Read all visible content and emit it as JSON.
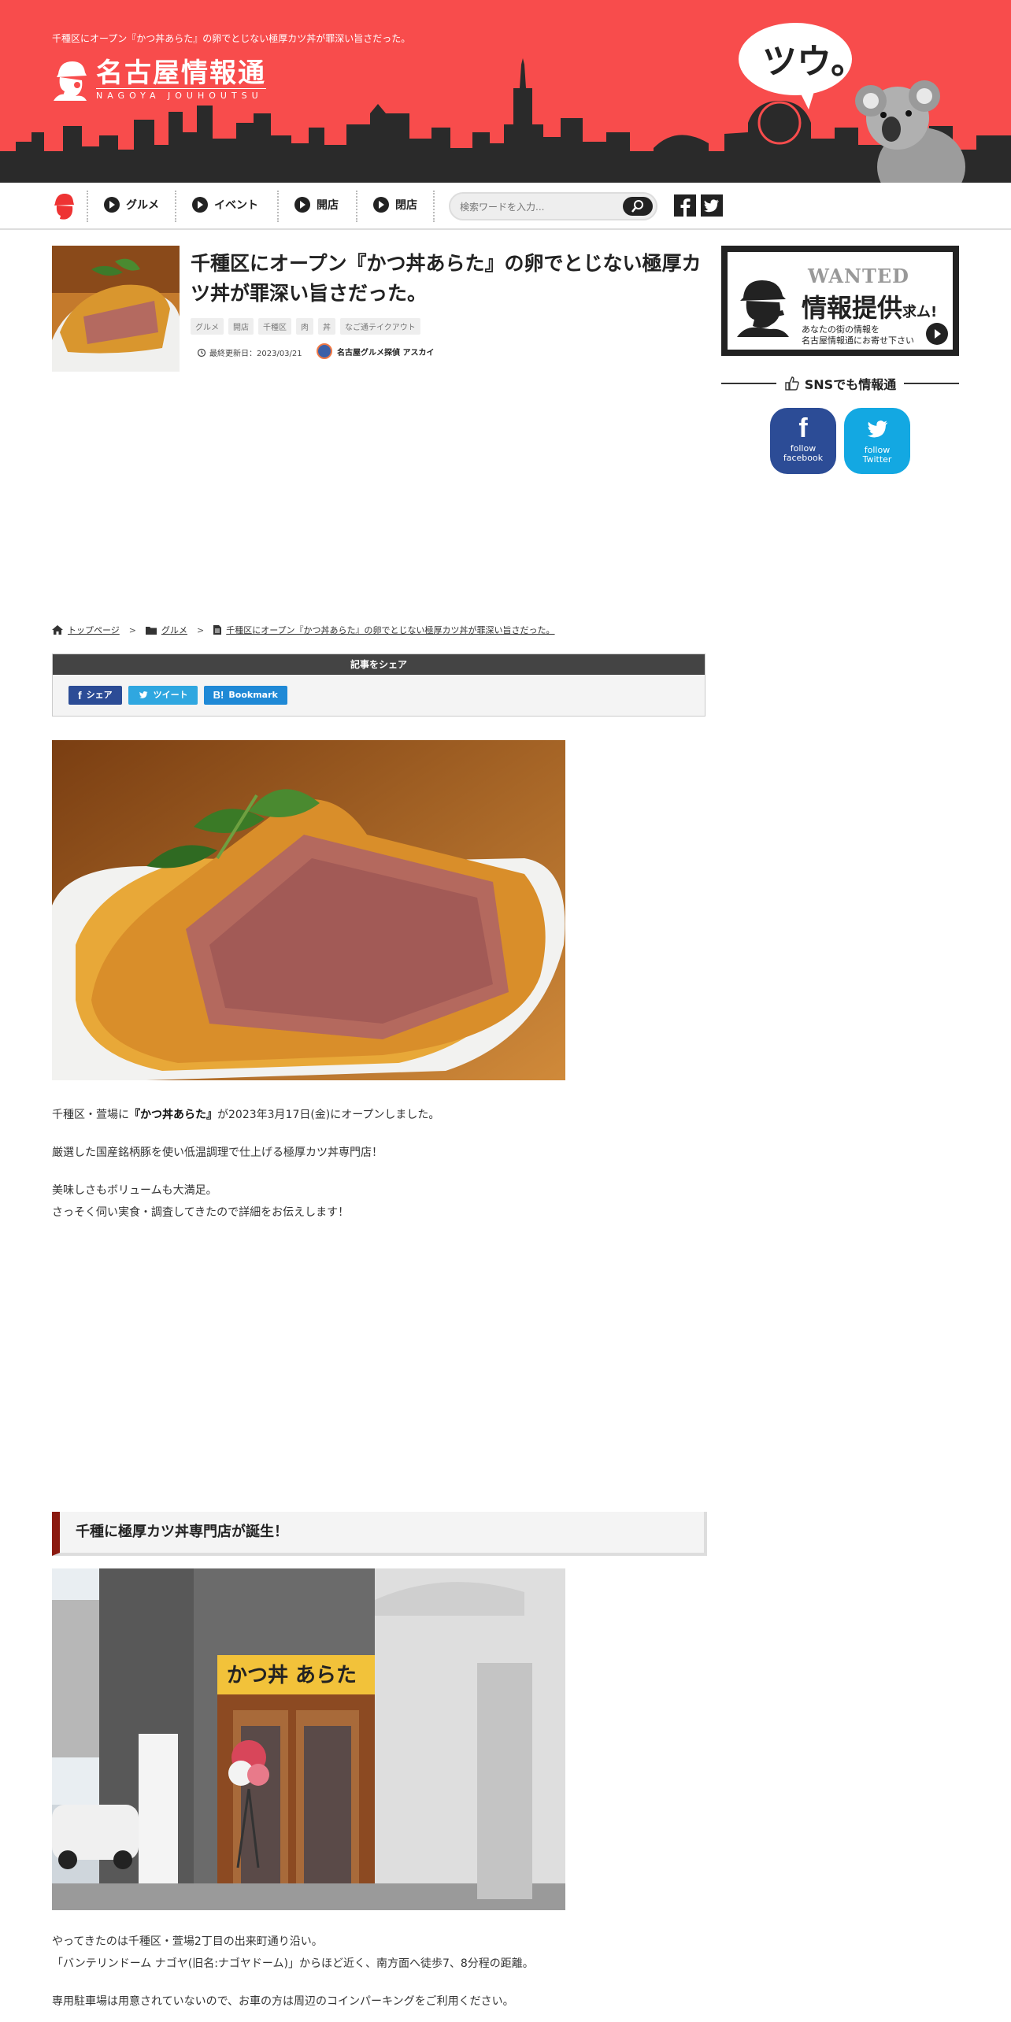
{
  "header": {
    "tagline": "千種区にオープン『かつ丼あらた』の卵でとじない極厚カツ丼が罪深い旨さだった。",
    "logo_main": "名古屋情報通",
    "logo_sub": "NAGOYA JOUHOUTSU",
    "bubble_text": "ツウ。"
  },
  "nav": {
    "items": [
      {
        "label": "グルメ"
      },
      {
        "label": "イベント"
      },
      {
        "label": "開店"
      },
      {
        "label": "閉店"
      }
    ],
    "search_placeholder": "検索ワードを入力..."
  },
  "article": {
    "title": "千種区にオープン『かつ丼あらた』の卵でとじない極厚カツ丼が罪深い旨さだった。",
    "tags": [
      "グルメ",
      "開店",
      "千種区",
      "肉",
      "丼",
      "なご通テイクアウト"
    ],
    "updated": "最終更新日：2023/03/21",
    "author": "名古屋グルメ探偵 アスカイ"
  },
  "breadcrumb": {
    "home": "トップページ",
    "category": "グルメ",
    "current": "千種区にオープン『かつ丼あらた』の卵でとじない極厚カツ丼が罪深い旨さだった。"
  },
  "share": {
    "heading": "記事をシェア",
    "facebook": "シェア",
    "twitter": "ツイート",
    "hatena": "Bookmark"
  },
  "body": {
    "p1_pre": "千種区・萱場に",
    "p1_bold": "『かつ丼あらた』",
    "p1_post": "が2023年3月17日(金)にオープンしました。",
    "p2": "厳選した国産銘柄豚を使い低温調理で仕上げる極厚カツ丼専門店！",
    "p3a": "美味しさもボリュームも大満足。",
    "p3b": "さっそく伺い実食・調査してきたので詳細をお伝えします！",
    "section_title": "千種に極厚カツ丼専門店が誕生！",
    "p4a": "やってきたのは千種区・萱場2丁目の出来町通り沿い。",
    "p4b": "「バンテリンドーム ナゴヤ(旧名:ナゴヤドーム)」からほど近く、南方面へ徒歩7、8分程の距離。",
    "p5": "専用駐車場は用意されていないので、お車の方は周辺のコインパーキングをご利用ください。"
  },
  "sidebar": {
    "wanted_title": "WANTED",
    "wanted_main": "情報提供",
    "wanted_suffix": "求ム!",
    "wanted_desc1": "あなたの街の情報を",
    "wanted_desc2": "名古屋情報通にお寄せ下さい",
    "sns_title": "SNSでも情報通",
    "fb_label1": "follow",
    "fb_label2": "facebook",
    "tw_label1": "follow",
    "tw_label2": "Twitter"
  },
  "colors": {
    "header_bg": "#f84c4c",
    "accent": "#8b1a10",
    "facebook": "#2c4c96",
    "twitter": "#13a8e2"
  }
}
